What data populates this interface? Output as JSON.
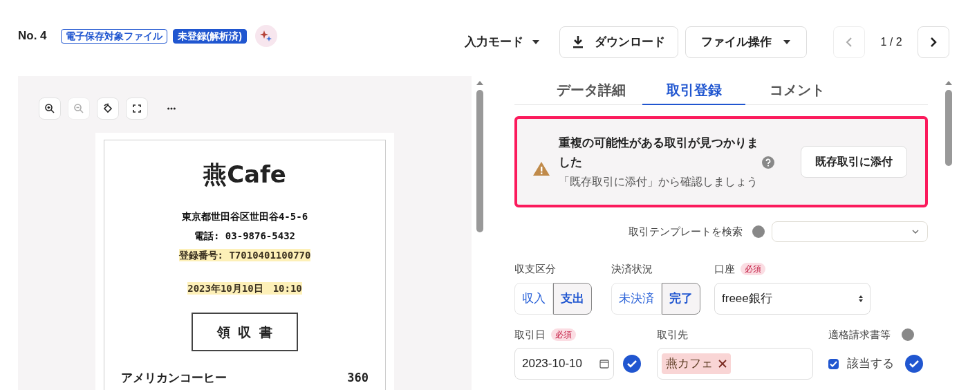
{
  "header": {
    "number": "No. 4",
    "tags": [
      {
        "label": "電子保存対象ファイル",
        "kind": "outline"
      },
      {
        "label": "未登録(解析済)",
        "kind": "filled"
      }
    ]
  },
  "toolbar": {
    "mode_menu": "入力モード",
    "download": "ダウンロード",
    "file_menu": "ファイル操作",
    "prev_disabled": true,
    "page": "1 / 2"
  },
  "preview": {
    "tools": [
      {
        "kind": "zoom-in",
        "disabled": false
      },
      {
        "kind": "zoom-out",
        "disabled": true
      },
      {
        "kind": "rotate",
        "disabled": false
      },
      {
        "kind": "fullscreen",
        "disabled": false
      },
      {
        "kind": "more",
        "disabled": false
      }
    ],
    "receipt": {
      "shop": "燕Cafe",
      "lines": [
        {
          "text": "東京都世田谷区世田谷4-5-6",
          "highlighted": false
        },
        {
          "text": "電話: 03-9876-5432",
          "highlighted": false
        },
        {
          "text": "登録番号: T7010401100770",
          "highlighted": true
        },
        {
          "text": "2023年10月10日　10:10",
          "highlighted": true
        }
      ],
      "title": "領 収 書",
      "items": [
        {
          "name": "アメリカンコーヒー",
          "price": "360"
        }
      ]
    }
  },
  "tabs": [
    {
      "label": "データ詳細",
      "selected": false
    },
    {
      "label": "取引登録",
      "selected": true
    },
    {
      "label": "コメント",
      "selected": false
    }
  ],
  "alert": {
    "title": "重複の可能性がある取引が見つかりました",
    "subtitle": "「既存取引に添付」から確認しましょう",
    "button": "既存取引に添付"
  },
  "template_search": {
    "label": "取引テンプレートを検索"
  },
  "income_expense": {
    "label": "収支区分",
    "options": [
      {
        "label": "収入",
        "selected": false
      },
      {
        "label": "支出",
        "selected": true
      }
    ]
  },
  "payment_status": {
    "label": "決済状況",
    "options": [
      {
        "label": "未決済",
        "selected": false
      },
      {
        "label": "完了",
        "selected": true
      }
    ]
  },
  "account": {
    "label": "口座",
    "required": "必須",
    "value": "freee銀行"
  },
  "date": {
    "label": "取引日",
    "required": "必須",
    "value": "2023-10-10"
  },
  "partner": {
    "label": "取引先",
    "tag": "燕カフェ"
  },
  "invoice": {
    "label": "適格請求書等",
    "checkbox_label": "該当する",
    "checked": true
  }
}
